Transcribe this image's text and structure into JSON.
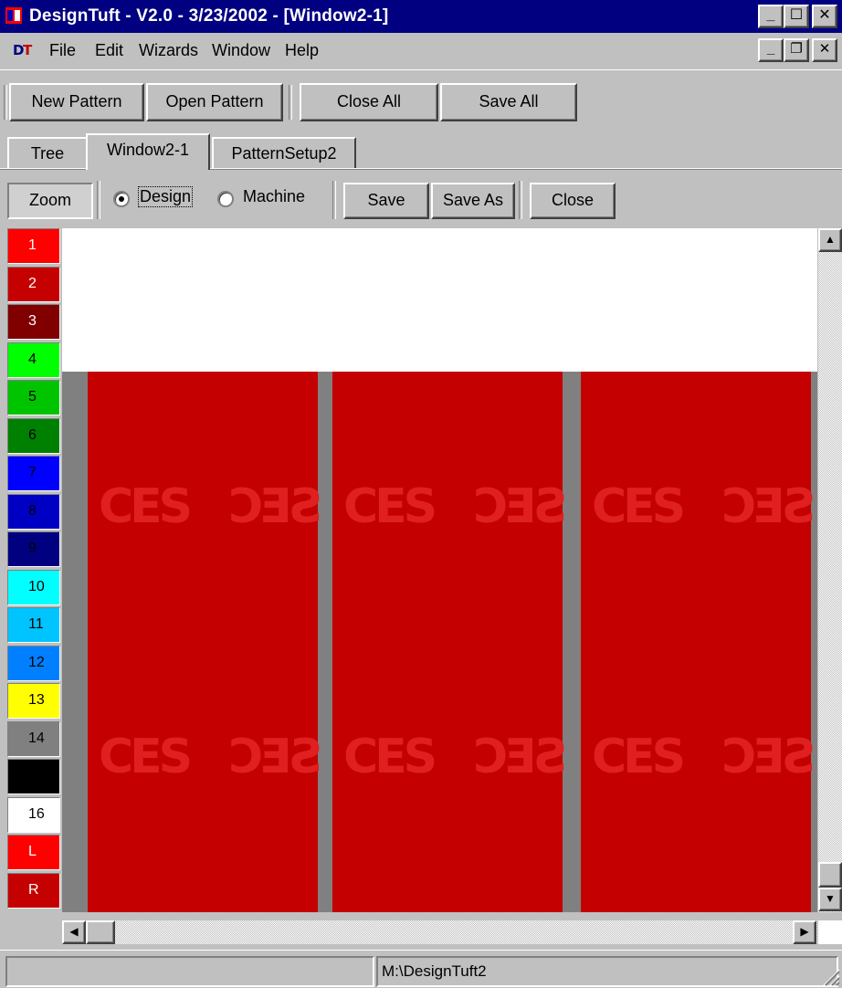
{
  "window": {
    "title": "DesignTuft - V2.0 - 3/23/2002 - [Window2-1]",
    "caption_buttons": {
      "minimize": "_",
      "maximize": "☐",
      "close": "✕"
    },
    "mdi_buttons": {
      "minimize": "_",
      "restore": "❐",
      "close": "✕"
    }
  },
  "menu": {
    "icon": "DT",
    "items": [
      "File",
      "Edit",
      "Wizards",
      "Window",
      "Help"
    ]
  },
  "toolbar": {
    "new_pattern": "New Pattern",
    "open_pattern": "Open Pattern",
    "close_all": "Close All",
    "save_all": "Save All"
  },
  "tabs": [
    {
      "label": "Tree",
      "active": false
    },
    {
      "label": "Window2-1",
      "active": true
    },
    {
      "label": "PatternSetup2",
      "active": false
    }
  ],
  "design_toolbar": {
    "zoom": "Zoom",
    "mode_design": "Design",
    "mode_machine": "Machine",
    "selected_mode": "Design",
    "save": "Save",
    "save_as": "Save As",
    "close": "Close"
  },
  "palette": [
    {
      "label": "1",
      "color": "#ff0000",
      "text_color": "#ffffff"
    },
    {
      "label": "2",
      "color": "#c40000",
      "text_color": "#ffffff"
    },
    {
      "label": "3",
      "color": "#800000",
      "text_color": "#ffffff"
    },
    {
      "label": "4",
      "color": "#00ff00",
      "text_color": "#000000"
    },
    {
      "label": "5",
      "color": "#00c400",
      "text_color": "#000000"
    },
    {
      "label": "6",
      "color": "#008000",
      "text_color": "#000000"
    },
    {
      "label": "7",
      "color": "#0000ff",
      "text_color": "#000000"
    },
    {
      "label": "8",
      "color": "#0000c4",
      "text_color": "#000000"
    },
    {
      "label": "9",
      "color": "#000080",
      "text_color": "#000000"
    },
    {
      "label": "10",
      "color": "#00ffff",
      "text_color": "#000000"
    },
    {
      "label": "11",
      "color": "#00c4ff",
      "text_color": "#000000"
    },
    {
      "label": "12",
      "color": "#0080ff",
      "text_color": "#000000"
    },
    {
      "label": "13",
      "color": "#ffff00",
      "text_color": "#000000"
    },
    {
      "label": "14",
      "color": "#808080",
      "text_color": "#000000"
    },
    {
      "label": "",
      "color": "#000000",
      "text_color": "#ffffff"
    },
    {
      "label": "16",
      "color": "#ffffff",
      "text_color": "#000000"
    },
    {
      "label": "L",
      "color": "#ff0000",
      "text_color": "#ffffff"
    },
    {
      "label": "R",
      "color": "#c40000",
      "text_color": "#ffffff"
    }
  ],
  "canvas": {
    "background": "#ffffff",
    "design_color": "#c40000",
    "divider_color": "#808080",
    "motif_top_left": "CES",
    "motif_top_right": "SEC",
    "motif_bottom_left": "CES",
    "motif_bottom_right": "SEC"
  },
  "statusbar": {
    "left": "",
    "path": "M:\\DesignTuft2"
  }
}
